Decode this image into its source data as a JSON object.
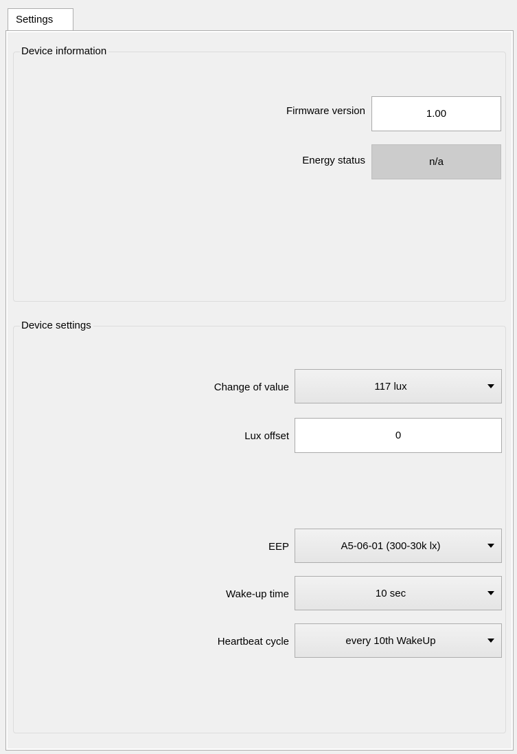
{
  "tabs": [
    {
      "label": "Settings"
    }
  ],
  "device_information": {
    "title": "Device information",
    "firmware_version": {
      "label": "Firmware version",
      "value": "1.00"
    },
    "energy_status": {
      "label": "Energy status",
      "value": "n/a"
    }
  },
  "device_settings": {
    "title": "Device settings",
    "change_of_value": {
      "label": "Change of value",
      "value": "117 lux"
    },
    "lux_offset": {
      "label": "Lux offset",
      "value": "0"
    },
    "eep": {
      "label": "EEP",
      "value": "A5-06-01 (300-30k lx)"
    },
    "wake_up_time": {
      "label": "Wake-up time",
      "value": "10 sec"
    },
    "heartbeat_cycle": {
      "label": "Heartbeat cycle",
      "value": "every 10th WakeUp"
    }
  },
  "icons": {
    "dropdown": "chevron-down-icon"
  }
}
